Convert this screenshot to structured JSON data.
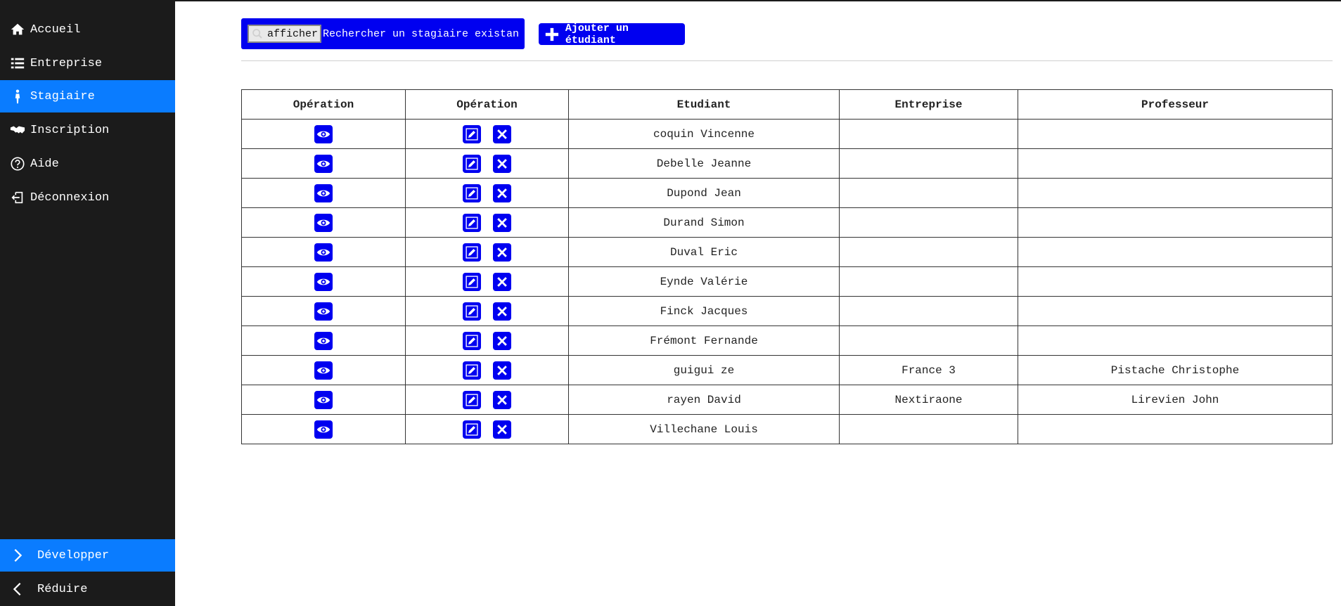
{
  "sidebar": {
    "items": [
      {
        "label": "Accueil",
        "icon": "home-icon"
      },
      {
        "label": "Entreprise",
        "icon": "list-icon"
      },
      {
        "label": "Stagiaire",
        "icon": "person-icon",
        "active": true
      },
      {
        "label": "Inscription",
        "icon": "handshake-icon"
      },
      {
        "label": "Aide",
        "icon": "question-icon"
      },
      {
        "label": "Déconnexion",
        "icon": "logout-icon"
      }
    ],
    "expand_label": "Développer",
    "collapse_label": "Réduire"
  },
  "toolbar": {
    "search_button_label": "afficher",
    "search_placeholder": "Rechercher un stagiaire existant",
    "add_label": "Ajouter un étudiant"
  },
  "colors": {
    "accent": "#0a7cff",
    "button_blue": "#0000f0",
    "sidebar_bg": "#1b1b1b"
  },
  "table": {
    "headers": [
      "Opération",
      "Opération",
      "Etudiant",
      "Entreprise",
      "Professeur"
    ],
    "rows": [
      {
        "etudiant": "coquin Vincenne",
        "entreprise": "",
        "professeur": ""
      },
      {
        "etudiant": "Debelle Jeanne",
        "entreprise": "",
        "professeur": ""
      },
      {
        "etudiant": "Dupond Jean",
        "entreprise": "",
        "professeur": ""
      },
      {
        "etudiant": "Durand Simon",
        "entreprise": "",
        "professeur": ""
      },
      {
        "etudiant": "Duval Eric",
        "entreprise": "",
        "professeur": ""
      },
      {
        "etudiant": "Eynde Valérie",
        "entreprise": "",
        "professeur": ""
      },
      {
        "etudiant": "Finck Jacques",
        "entreprise": "",
        "professeur": ""
      },
      {
        "etudiant": "Frémont Fernande",
        "entreprise": "",
        "professeur": ""
      },
      {
        "etudiant": "guigui ze",
        "entreprise": "France 3",
        "professeur": "Pistache Christophe"
      },
      {
        "etudiant": "rayen David",
        "entreprise": "Nextiraone",
        "professeur": "Lirevien John"
      },
      {
        "etudiant": "Villechane Louis",
        "entreprise": "",
        "professeur": ""
      }
    ]
  }
}
